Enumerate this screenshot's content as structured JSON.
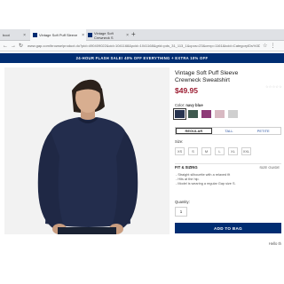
{
  "browser": {
    "tabs": [
      {
        "label": "boot",
        "active": false
      },
      {
        "label": "Vintage Soft Puff Sleeve ",
        "active": true
      },
      {
        "label": "Vintage Soft Crewneck S",
        "active": false
      }
    ],
    "new_tab": "+",
    "url": "www.gap.com/browse/product.do?pid=490409022&cid=1041168&pcid=1041168&grid=pds_31_113_1&cpos=23&cexp=1161&kcid=CategoryIDs%3D1041168&cvar=9416&ctype=Listing&cpid=res20011509580064862719054#pdp-page-content"
  },
  "promo": {
    "text": "24-HOUR FLASH SALE! 40% OFF EVERYTHING + EXTRA 10% OFF"
  },
  "product": {
    "title": "Vintage Soft Puff Sleeve Crewneck Sweatshirt",
    "stars": "☆☆☆☆☆",
    "price": "$49.95",
    "color_label": "Color:",
    "color_value": "navy blue",
    "swatch_colors": [
      "#26334f",
      "#3f5a4f",
      "#8e3b78",
      "#d8b9c2",
      "#cfcfcf"
    ],
    "fits": [
      "REGULAR",
      "TALL",
      "PETITE"
    ],
    "size_label": "Size:",
    "sizes": [
      "XS",
      "S",
      "M",
      "L",
      "XL",
      "XXL"
    ],
    "fit_title": "FIT & SIZING",
    "size_guide": "SIZE GUIDE",
    "fit_notes": [
      "Straight silhouette with a relaxed fit",
      "Hits at the hip.",
      "Model is wearing a regular Gap size S."
    ],
    "quantity_label": "Quantity:",
    "quantity_value": "1",
    "add_to_bag": "ADD TO BAG"
  },
  "help": {
    "text": "Hello th"
  },
  "colors": {
    "brand_navy": "#002d72",
    "price_red": "#9b1c31"
  }
}
